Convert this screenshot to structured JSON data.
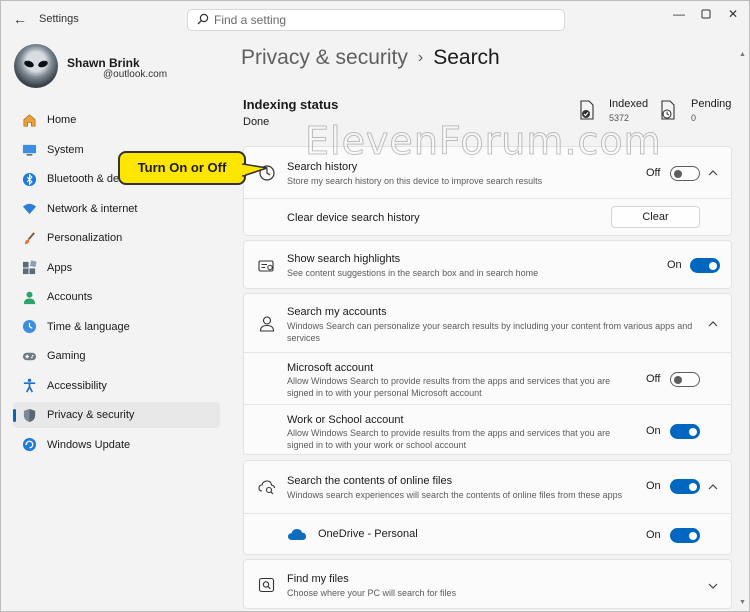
{
  "window": {
    "title": "Settings"
  },
  "search": {
    "placeholder": "Find a setting"
  },
  "profile": {
    "name": "Shawn Brink",
    "email": "@outlook.com"
  },
  "sidebar": {
    "items": [
      {
        "label": "Home",
        "icon": "home-icon"
      },
      {
        "label": "System",
        "icon": "monitor-icon"
      },
      {
        "label": "Bluetooth & devices",
        "icon": "bluetooth-icon"
      },
      {
        "label": "Network & internet",
        "icon": "wifi-icon"
      },
      {
        "label": "Personalization",
        "icon": "brush-icon"
      },
      {
        "label": "Apps",
        "icon": "apps-icon"
      },
      {
        "label": "Accounts",
        "icon": "person-icon"
      },
      {
        "label": "Time & language",
        "icon": "globe-clock-icon"
      },
      {
        "label": "Gaming",
        "icon": "gamepad-icon"
      },
      {
        "label": "Accessibility",
        "icon": "accessibility-icon"
      },
      {
        "label": "Privacy & security",
        "icon": "shield-icon",
        "selected": true
      },
      {
        "label": "Windows Update",
        "icon": "update-icon"
      }
    ]
  },
  "breadcrumb": {
    "parent": "Privacy & security",
    "separator": "›",
    "current": "Search"
  },
  "indexing": {
    "title": "Indexing status",
    "status": "Done",
    "indexed_label": "Indexed",
    "indexed_value": "5372",
    "pending_label": "Pending",
    "pending_value": "0"
  },
  "watermark": "ElevenForum.com",
  "callout": "Turn On or Off",
  "search_history": {
    "title": "Search history",
    "desc": "Store my search history on this device to improve search results",
    "state": "Off",
    "clear_label": "Clear device search history",
    "clear_button": "Clear"
  },
  "highlights": {
    "title": "Show search highlights",
    "desc": "See content suggestions in the search box and in search home",
    "state": "On"
  },
  "accounts": {
    "title": "Search my accounts",
    "desc": "Windows Search can personalize your search results by including your content from various apps and services",
    "microsoft": {
      "title": "Microsoft account",
      "desc": "Allow Windows Search to provide results from the apps and services that you are signed in to with your personal Microsoft account",
      "state": "Off"
    },
    "work": {
      "title": "Work or School account",
      "desc": "Allow Windows Search to provide results from the apps and services that you are signed in to with your work or school account",
      "state": "On"
    }
  },
  "online_files": {
    "title": "Search the contents of online files",
    "desc": "Windows search experiences will search the contents of online files from these apps",
    "state": "On",
    "onedrive": {
      "title": "OneDrive - Personal",
      "state": "On"
    }
  },
  "find_files": {
    "title": "Find my files",
    "desc": "Choose where your PC will search for files"
  },
  "colors": {
    "accent": "#0067c0",
    "callout": "#ffe600"
  }
}
